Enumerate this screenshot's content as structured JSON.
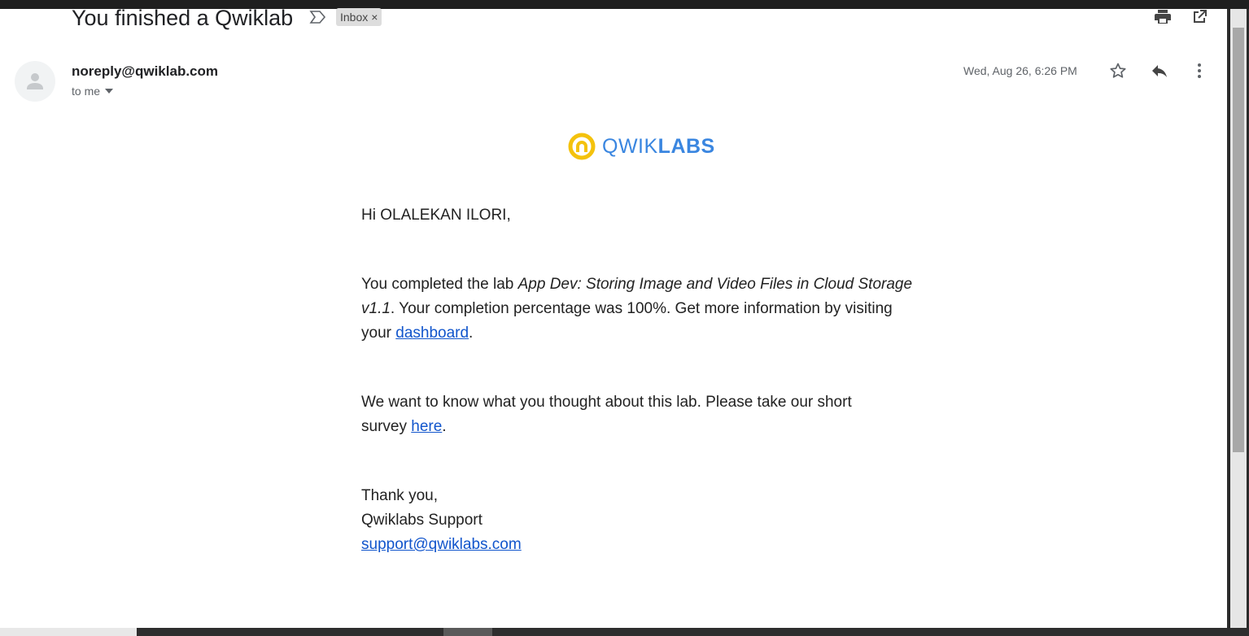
{
  "email": {
    "subject": "You finished a Qwiklab",
    "label_chip": "Inbox",
    "label_remove": "×",
    "sender": "noreply@qwiklab.com",
    "recipient_line": "to me",
    "date": "Wed, Aug 26, 6:26 PM"
  },
  "icons": {
    "important": "label-important-icon",
    "print": "print-icon",
    "open_new_window": "open-in-new-window-icon",
    "avatar": "person-avatar-icon",
    "star": "star-icon",
    "reply": "reply-icon",
    "more": "more-vert-icon",
    "dropdown": "caret-down-icon"
  },
  "message": {
    "logo_text_light": "QWIK",
    "logo_text_bold": "LABS",
    "greeting": "Hi OLALEKAN ILORI,",
    "p1_before": "You completed the lab ",
    "p1_lab": "App Dev: Storing Image and Video Files in Cloud Storage v1.1",
    "p1_after": ". Your completion percentage was 100%. Get more information by visiting your ",
    "p1_link": "dashboard",
    "p1_end": ".",
    "p2_before": "We want to know what you thought about this lab. Please take our short survey ",
    "p2_link": "here",
    "p2_end": ".",
    "signoff": "Thank you,",
    "signature": "Qwiklabs Support",
    "support_email": "support@qwiklabs.com"
  },
  "colors": {
    "link": "#1155cc",
    "logo_blue": "#3a86e0",
    "logo_yellow": "#f4c20d"
  }
}
